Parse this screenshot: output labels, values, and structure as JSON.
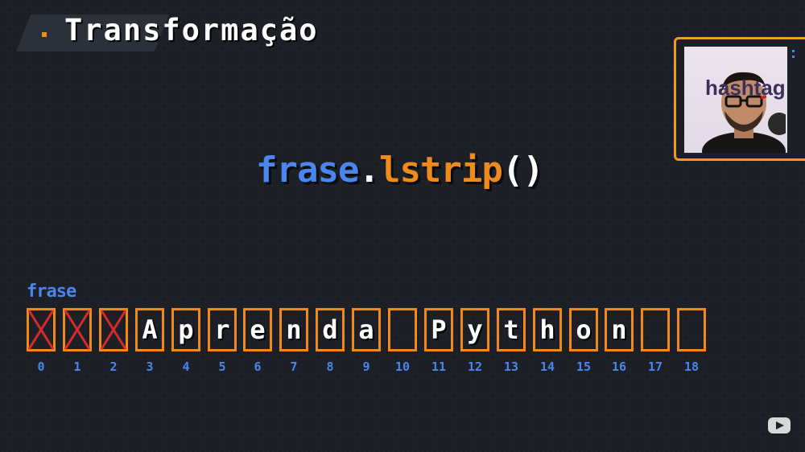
{
  "title": "Transformação",
  "code": {
    "object": "frase",
    "dot": ".",
    "method": "lstrip",
    "parens": "()"
  },
  "array": {
    "label": "frase",
    "cells": [
      {
        "index": "0",
        "char": "",
        "removed": true
      },
      {
        "index": "1",
        "char": "",
        "removed": true
      },
      {
        "index": "2",
        "char": "",
        "removed": true
      },
      {
        "index": "3",
        "char": "A",
        "removed": false
      },
      {
        "index": "4",
        "char": "p",
        "removed": false
      },
      {
        "index": "5",
        "char": "r",
        "removed": false
      },
      {
        "index": "6",
        "char": "e",
        "removed": false
      },
      {
        "index": "7",
        "char": "n",
        "removed": false
      },
      {
        "index": "8",
        "char": "d",
        "removed": false
      },
      {
        "index": "9",
        "char": "a",
        "removed": false
      },
      {
        "index": "10",
        "char": "",
        "removed": false
      },
      {
        "index": "11",
        "char": "P",
        "removed": false
      },
      {
        "index": "12",
        "char": "y",
        "removed": false
      },
      {
        "index": "13",
        "char": "t",
        "removed": false
      },
      {
        "index": "14",
        "char": "h",
        "removed": false
      },
      {
        "index": "15",
        "char": "o",
        "removed": false
      },
      {
        "index": "16",
        "char": "n",
        "removed": false
      },
      {
        "index": "17",
        "char": "",
        "removed": false
      },
      {
        "index": "18",
        "char": "",
        "removed": false
      }
    ]
  },
  "webcam": {
    "logo_text": "hashtag"
  },
  "colors": {
    "accent_orange": "#ef8a1b",
    "accent_blue": "#4a86f0",
    "removed_x": "#d62b2b",
    "background": "#1d1f26"
  },
  "icons": {
    "youtube": "youtube-play-icon"
  }
}
